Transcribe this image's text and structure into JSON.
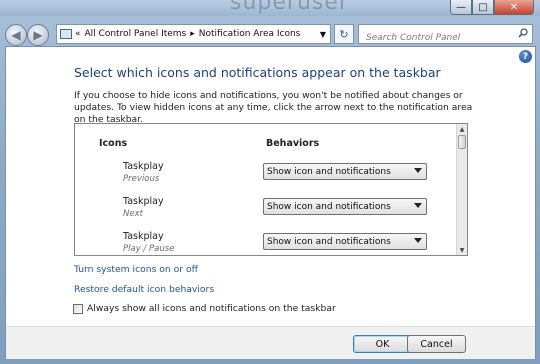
{
  "titlebar": {
    "background_text": "superuser"
  },
  "address": {
    "crumbs": [
      "All Control Panel Items",
      "Notification Area Icons"
    ],
    "overflow_glyph": "«"
  },
  "search": {
    "placeholder": "Search Control Panel"
  },
  "content": {
    "heading": "Select which icons and notifications appear on the taskbar",
    "description": "If you choose to hide icons and notifications, you won't be notified about changes or updates. To view hidden icons at any time, click the arrow next to the notification area on the taskbar.",
    "list": {
      "col_icons": "Icons",
      "col_behaviors": "Behaviors",
      "rows": [
        {
          "name": "Taskplay",
          "sub": "Previous",
          "behavior": "Show icon and notifications"
        },
        {
          "name": "Taskplay",
          "sub": "Next",
          "behavior": "Show icon and notifications"
        },
        {
          "name": "Taskplay",
          "sub": "Play / Pause",
          "behavior": "Show icon and notifications"
        }
      ]
    },
    "link_system_icons": "Turn system icons on or off",
    "link_restore": "Restore default icon behaviors",
    "checkbox_label": "Always show all icons and notifications on the taskbar"
  },
  "buttons": {
    "ok": "OK",
    "cancel": "Cancel"
  },
  "colors": {
    "heading": "#1e3f85",
    "link": "#1e55a8",
    "frame": "#8fa8c0"
  }
}
